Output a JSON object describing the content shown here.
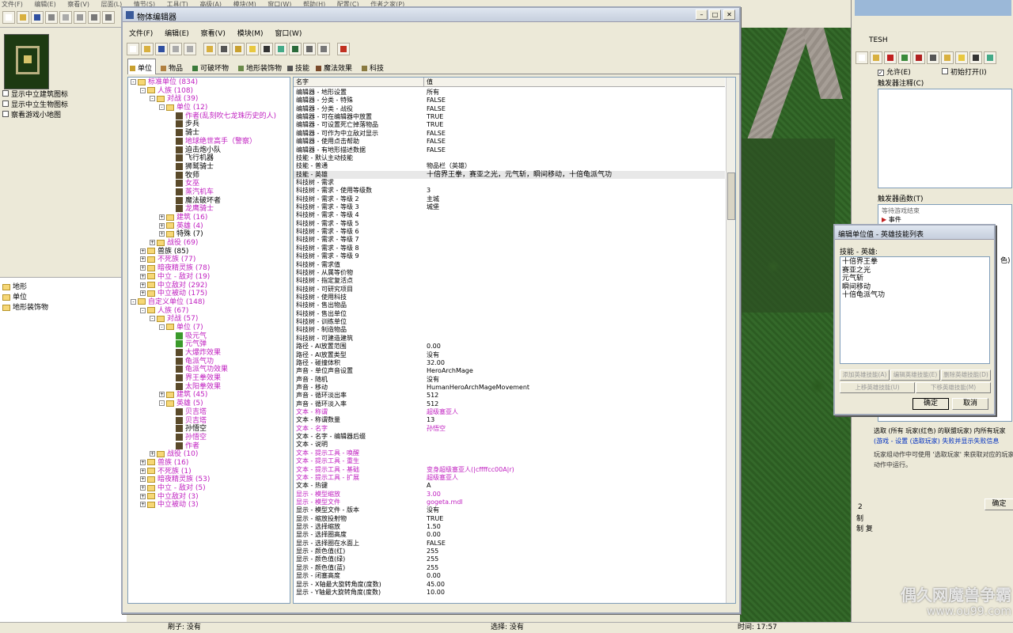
{
  "main_menu": [
    "文件(F)",
    "编辑(E)",
    "察看(V)",
    "层面(L)",
    "情节(S)",
    "工具(T)",
    "高级(A)",
    "模块(M)",
    "窗口(W)",
    "帮助(H)",
    "配置(C)",
    "作者之家(P)"
  ],
  "left_checks": [
    "显示中立建筑图标",
    "显示中立生物图标",
    "察看游戏小地图"
  ],
  "left_palette": [
    "地形",
    "单位",
    "地形装饰物"
  ],
  "editor": {
    "title": "物体编辑器",
    "menu": [
      "文件(F)",
      "编辑(E)",
      "察看(V)",
      "模块(M)",
      "窗口(W)"
    ],
    "tabs": [
      "单位",
      "物品",
      "可破坏物",
      "地形装饰物",
      "技能",
      "魔法效果",
      "科技"
    ],
    "col_name": "名字",
    "col_value": "值"
  },
  "tree": [
    {
      "d": 0,
      "e": "-",
      "i": "f",
      "t": "标准单位 (834)",
      "m": true
    },
    {
      "d": 1,
      "e": "-",
      "i": "f",
      "t": "人族 (108)",
      "m": true
    },
    {
      "d": 2,
      "e": "-",
      "i": "f",
      "t": "对战 (39)",
      "m": true
    },
    {
      "d": 3,
      "e": "-",
      "i": "f",
      "t": "单位 (12)",
      "m": true
    },
    {
      "d": 4,
      "e": "",
      "i": "u",
      "t": "作者(乱刻吹七龙珠历史的人)",
      "m": true
    },
    {
      "d": 4,
      "e": "",
      "i": "u",
      "t": "步兵",
      "m": false
    },
    {
      "d": 4,
      "e": "",
      "i": "u",
      "t": "骑士",
      "m": false
    },
    {
      "d": 4,
      "e": "",
      "i": "u",
      "t": "地球绝世高手（警察）",
      "m": true
    },
    {
      "d": 4,
      "e": "",
      "i": "u",
      "t": "迫击炮小队",
      "m": false
    },
    {
      "d": 4,
      "e": "",
      "i": "u",
      "t": "飞行机器",
      "m": false
    },
    {
      "d": 4,
      "e": "",
      "i": "u",
      "t": "狮鹫骑士",
      "m": false
    },
    {
      "d": 4,
      "e": "",
      "i": "u",
      "t": "牧师",
      "m": false
    },
    {
      "d": 4,
      "e": "",
      "i": "u",
      "t": "女巫",
      "m": true
    },
    {
      "d": 4,
      "e": "",
      "i": "u",
      "t": "蒸汽机车",
      "m": true
    },
    {
      "d": 4,
      "e": "",
      "i": "u",
      "t": "魔法破坏者",
      "m": false
    },
    {
      "d": 4,
      "e": "",
      "i": "u",
      "t": "龙鹰骑士",
      "m": true
    },
    {
      "d": 3,
      "e": "+",
      "i": "f",
      "t": "建筑 (16)",
      "m": true
    },
    {
      "d": 3,
      "e": "+",
      "i": "f",
      "t": "英雄 (4)",
      "m": true
    },
    {
      "d": 3,
      "e": "+",
      "i": "f",
      "t": "特殊 (7)",
      "m": false
    },
    {
      "d": 2,
      "e": "+",
      "i": "f",
      "t": "战役 (69)",
      "m": true
    },
    {
      "d": 1,
      "e": "+",
      "i": "f",
      "t": "兽族 (85)",
      "m": false
    },
    {
      "d": 1,
      "e": "+",
      "i": "f",
      "t": "不死族 (77)",
      "m": true
    },
    {
      "d": 1,
      "e": "+",
      "i": "f",
      "t": "暗夜精灵族 (78)",
      "m": true
    },
    {
      "d": 1,
      "e": "+",
      "i": "f",
      "t": "中立 - 敌对 (19)",
      "m": true
    },
    {
      "d": 1,
      "e": "+",
      "i": "f",
      "t": "中立敌对 (292)",
      "m": true
    },
    {
      "d": 1,
      "e": "+",
      "i": "f",
      "t": "中立被动 (175)",
      "m": true
    },
    {
      "d": 0,
      "e": "-",
      "i": "f",
      "t": "自定义单位 (148)",
      "m": true
    },
    {
      "d": 1,
      "e": "-",
      "i": "f",
      "t": "人族 (67)",
      "m": true
    },
    {
      "d": 2,
      "e": "-",
      "i": "f",
      "t": "对战 (57)",
      "m": true
    },
    {
      "d": 3,
      "e": "-",
      "i": "f",
      "t": "单位 (7)",
      "m": true
    },
    {
      "d": 4,
      "e": "",
      "i": "g",
      "t": "吸元气",
      "m": true
    },
    {
      "d": 4,
      "e": "",
      "i": "g",
      "t": "元气弹",
      "m": true
    },
    {
      "d": 4,
      "e": "",
      "i": "u",
      "t": "大爆炸效果",
      "m": true
    },
    {
      "d": 4,
      "e": "",
      "i": "u",
      "t": "龟派气功",
      "m": true
    },
    {
      "d": 4,
      "e": "",
      "i": "u",
      "t": "龟派气功效果",
      "m": true
    },
    {
      "d": 4,
      "e": "",
      "i": "u",
      "t": "界王拳效果",
      "m": true
    },
    {
      "d": 4,
      "e": "",
      "i": "u",
      "t": "太阳拳效果",
      "m": true
    },
    {
      "d": 3,
      "e": "+",
      "i": "f",
      "t": "建筑 (45)",
      "m": true
    },
    {
      "d": 3,
      "e": "-",
      "i": "f",
      "t": "英雄 (5)",
      "m": true
    },
    {
      "d": 4,
      "e": "",
      "i": "u",
      "t": "贝吉塔",
      "m": true
    },
    {
      "d": 4,
      "e": "",
      "i": "u",
      "t": "贝吉塔",
      "m": true
    },
    {
      "d": 4,
      "e": "",
      "i": "u",
      "t": "孙悟空",
      "m": false
    },
    {
      "d": 4,
      "e": "",
      "i": "u",
      "t": "孙悟空",
      "m": true
    },
    {
      "d": 4,
      "e": "",
      "i": "u",
      "t": "作者",
      "m": true
    },
    {
      "d": 2,
      "e": "+",
      "i": "f",
      "t": "战役 (10)",
      "m": true
    },
    {
      "d": 1,
      "e": "+",
      "i": "f",
      "t": "兽族 (16)",
      "m": true
    },
    {
      "d": 1,
      "e": "+",
      "i": "f",
      "t": "不死族 (1)",
      "m": true
    },
    {
      "d": 1,
      "e": "+",
      "i": "f",
      "t": "暗夜精灵族 (53)",
      "m": true
    },
    {
      "d": 1,
      "e": "+",
      "i": "f",
      "t": "中立 - 敌对 (5)",
      "m": true
    },
    {
      "d": 1,
      "e": "+",
      "i": "f",
      "t": "中立敌对 (3)",
      "m": true
    },
    {
      "d": 1,
      "e": "+",
      "i": "f",
      "t": "中立被动 (3)",
      "m": true
    }
  ],
  "props": [
    [
      "编辑器 - 地形设置",
      "所有",
      0
    ],
    [
      "编辑器 - 分类 - 特殊",
      "FALSE",
      0
    ],
    [
      "编辑器 - 分类 - 战役",
      "FALSE",
      0
    ],
    [
      "编辑器 - 可在编辑器中放置",
      "TRUE",
      0
    ],
    [
      "编辑器 - 可设置死亡掉落物品",
      "TRUE",
      0
    ],
    [
      "编辑器 - 可作为中立敌对显示",
      "FALSE",
      0
    ],
    [
      "编辑器 - 使用点击帮助",
      "FALSE",
      0
    ],
    [
      "编辑器 - 有地形描述数据",
      "FALSE",
      0
    ],
    [
      "技能 - 默认主动技能",
      "",
      0
    ],
    [
      "技能 - 普通",
      "物品栏（英雄）",
      0
    ],
    [
      "技能 - 英雄",
      "十倍界王拳，赛亚之光，元气斩，瞬间移动，十倍龟派气功",
      2
    ],
    [
      "科技树 - 需求",
      "",
      0
    ],
    [
      "科技树 - 需求 - 使用等级数",
      "3",
      0
    ],
    [
      "科技树 - 需求 - 等级 2",
      "主城",
      0
    ],
    [
      "科技树 - 需求 - 等级 3",
      "城堡",
      0
    ],
    [
      "科技树 - 需求 - 等级 4",
      "",
      0
    ],
    [
      "科技树 - 需求 - 等级 5",
      "",
      0
    ],
    [
      "科技树 - 需求 - 等级 6",
      "",
      0
    ],
    [
      "科技树 - 需求 - 等级 7",
      "",
      0
    ],
    [
      "科技树 - 需求 - 等级 8",
      "",
      0
    ],
    [
      "科技树 - 需求 - 等级 9",
      "",
      0
    ],
    [
      "科技树 - 需求值",
      "",
      0
    ],
    [
      "科技树 - 从属等价物",
      "",
      0
    ],
    [
      "科技树 - 指定复活点",
      "",
      0
    ],
    [
      "科技树 - 可研究项目",
      "",
      0
    ],
    [
      "科技树 - 使用科技",
      "",
      0
    ],
    [
      "科技树 - 售出物品",
      "",
      0
    ],
    [
      "科技树 - 售出单位",
      "",
      0
    ],
    [
      "科技树 - 训练单位",
      "",
      0
    ],
    [
      "科技树 - 制造物品",
      "",
      0
    ],
    [
      "科技树 - 可建造建筑",
      "",
      0
    ],
    [
      "路径 - AI放置范围",
      "0.00",
      0
    ],
    [
      "路径 - AI放置类型",
      "没有",
      0
    ],
    [
      "路径 - 碰撞体积",
      "32.00",
      0
    ],
    [
      "声音 - 单位声音设置",
      "HeroArchMage",
      0
    ],
    [
      "声音 - 随机",
      "没有",
      0
    ],
    [
      "声音 - 移动",
      "HumanHeroArchMageMovement",
      0
    ],
    [
      "声音 - 循环淡出率",
      "512",
      0
    ],
    [
      "声音 - 循环淡入率",
      "512",
      0
    ],
    [
      "文本 - 称谓",
      "超级塞亚人",
      1
    ],
    [
      "文本 - 称谓数量",
      "13",
      0
    ],
    [
      "文本 - 名字",
      "孙悟空",
      1
    ],
    [
      "文本 - 名字 - 编辑器后缀",
      "",
      0
    ],
    [
      "文本 - 说明",
      "",
      0
    ],
    [
      "文本 - 提示工具 - 唤醒",
      "",
      1
    ],
    [
      "文本 - 提示工具 - 重生",
      "",
      1
    ],
    [
      "文本 - 提示工具 - 基础",
      "变身超级塞亚人(|cffffcc00A|r)",
      1
    ],
    [
      "文本 - 提示工具 - 扩展",
      "超级塞亚人",
      1
    ],
    [
      "文本 - 热键",
      "A",
      0
    ],
    [
      "显示 - 模型缩放",
      "3.00",
      1
    ],
    [
      "显示 - 模型文件",
      "gogeta.mdl",
      1
    ],
    [
      "显示 - 模型文件 - 版本",
      "没有",
      0
    ],
    [
      "显示 - 缩放投射物",
      "TRUE",
      0
    ],
    [
      "显示 - 选择缩放",
      "1.50",
      0
    ],
    [
      "显示 - 选择圈高度",
      "0.00",
      0
    ],
    [
      "显示 - 选择圈在水面上",
      "FALSE",
      0
    ],
    [
      "显示 - 颜色值(红)",
      "255",
      0
    ],
    [
      "显示 - 颜色值(绿)",
      "255",
      0
    ],
    [
      "显示 - 颜色值(蓝)",
      "255",
      0
    ],
    [
      "显示 - 闭塞高度",
      "0.00",
      0
    ],
    [
      "显示 - X轴最大旋转角度(度数)",
      "45.00",
      0
    ],
    [
      "显示 - Y轴最大旋转角度(度数)",
      "10.00",
      0
    ]
  ],
  "right_panel": {
    "tab_name": "TESH",
    "allow_label": "允许(E)",
    "init_open_label": "初始打开(I)",
    "comment_label": "触发器注释(C)",
    "func_label": "触发器函数(T)",
    "func_items": [
      "等待游戏结束",
      "事件"
    ],
    "action_text": "选取 (所有 玩家(红色) 的联盟玩家) 内所有玩家",
    "action_text2": "(游戏 - 设置 (选取玩家) 失败并显示失败信息",
    "note_text": "玩家组动作中可使用 '选取玩家' 来获取对应的玩家",
    "note_text2": "动作中运行。",
    "ok_label": "确定",
    "digit_2": "2",
    "ctrl_a": "制",
    "ctrl_b": "制 复"
  },
  "dialog": {
    "title": "编辑单位值 - 英雄技能列表",
    "label": "技能 - 英雄:",
    "skills": [
      "十倍界王拳",
      "赛亚之光",
      "元气斩",
      "瞬间移动",
      "十倍龟派气功"
    ],
    "add": "添加英雄技能(A)",
    "edit": "编辑英雄技能(E)",
    "del": "删除英雄技能(D)",
    "up": "上移英雄技能(U)",
    "down": "下移英雄技能(M)",
    "ok": "确定",
    "cancel": "取消"
  },
  "status": {
    "brush": "刷子: 没有",
    "select": "选择: 没有",
    "time": "时间: 17:57"
  },
  "watermark": {
    "line1": "偶久网魔兽争霸",
    "line2": "www.ou99.com"
  },
  "right_side_text": "色)"
}
